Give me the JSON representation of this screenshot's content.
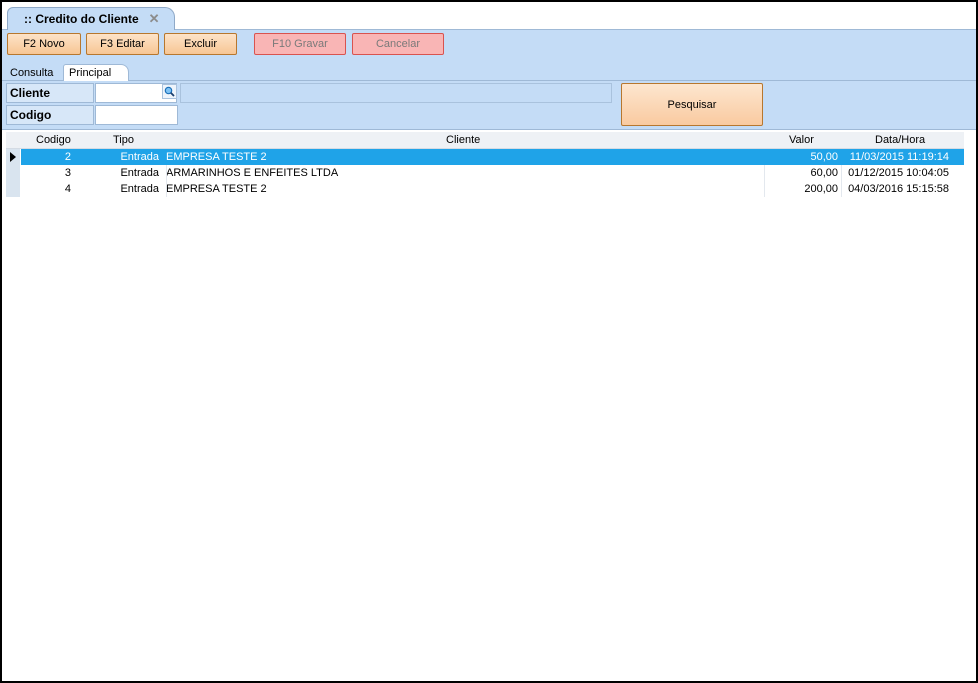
{
  "window": {
    "tab_title": ":: Credito do Cliente",
    "tab_close": "✕"
  },
  "toolbar": {
    "novo": "F2 Novo",
    "editar": "F3 Editar",
    "excluir": "Excluir",
    "gravar": "F10 Gravar",
    "cancelar": "Cancelar"
  },
  "subtabs": {
    "consulta": "Consulta",
    "principal": "Principal"
  },
  "filters": {
    "cliente_label": "Cliente",
    "cliente_value": "",
    "codigo_label": "Codigo",
    "codigo_value": "",
    "search_button": "Pesquisar"
  },
  "grid": {
    "columns": {
      "codigo": "Codigo",
      "tipo": "Tipo",
      "cliente": "Cliente",
      "valor": "Valor",
      "data": "Data/Hora"
    },
    "rows": [
      {
        "codigo": "2",
        "tipo": "Entrada",
        "cliente": "EMPRESA TESTE 2",
        "valor": "50,00",
        "data": "11/03/2015 11:19:14",
        "selected": true
      },
      {
        "codigo": "3",
        "tipo": "Entrada",
        "cliente": "ARMARINHOS E ENFEITES LTDA",
        "valor": "60,00",
        "data": "01/12/2015 10:04:05",
        "selected": false
      },
      {
        "codigo": "4",
        "tipo": "Entrada",
        "cliente": "EMPRESA TESTE 2",
        "valor": "200,00",
        "data": "04/03/2016 15:15:58",
        "selected": false
      }
    ]
  },
  "colors": {
    "panel": "#c4dcf6",
    "selection": "#1fa3e8",
    "button": "#f7c694",
    "disabled_button": "#f9b5b5"
  },
  "icons": {
    "lookup": "magnifier-icon",
    "row_pointer": "triangle-right-icon"
  }
}
